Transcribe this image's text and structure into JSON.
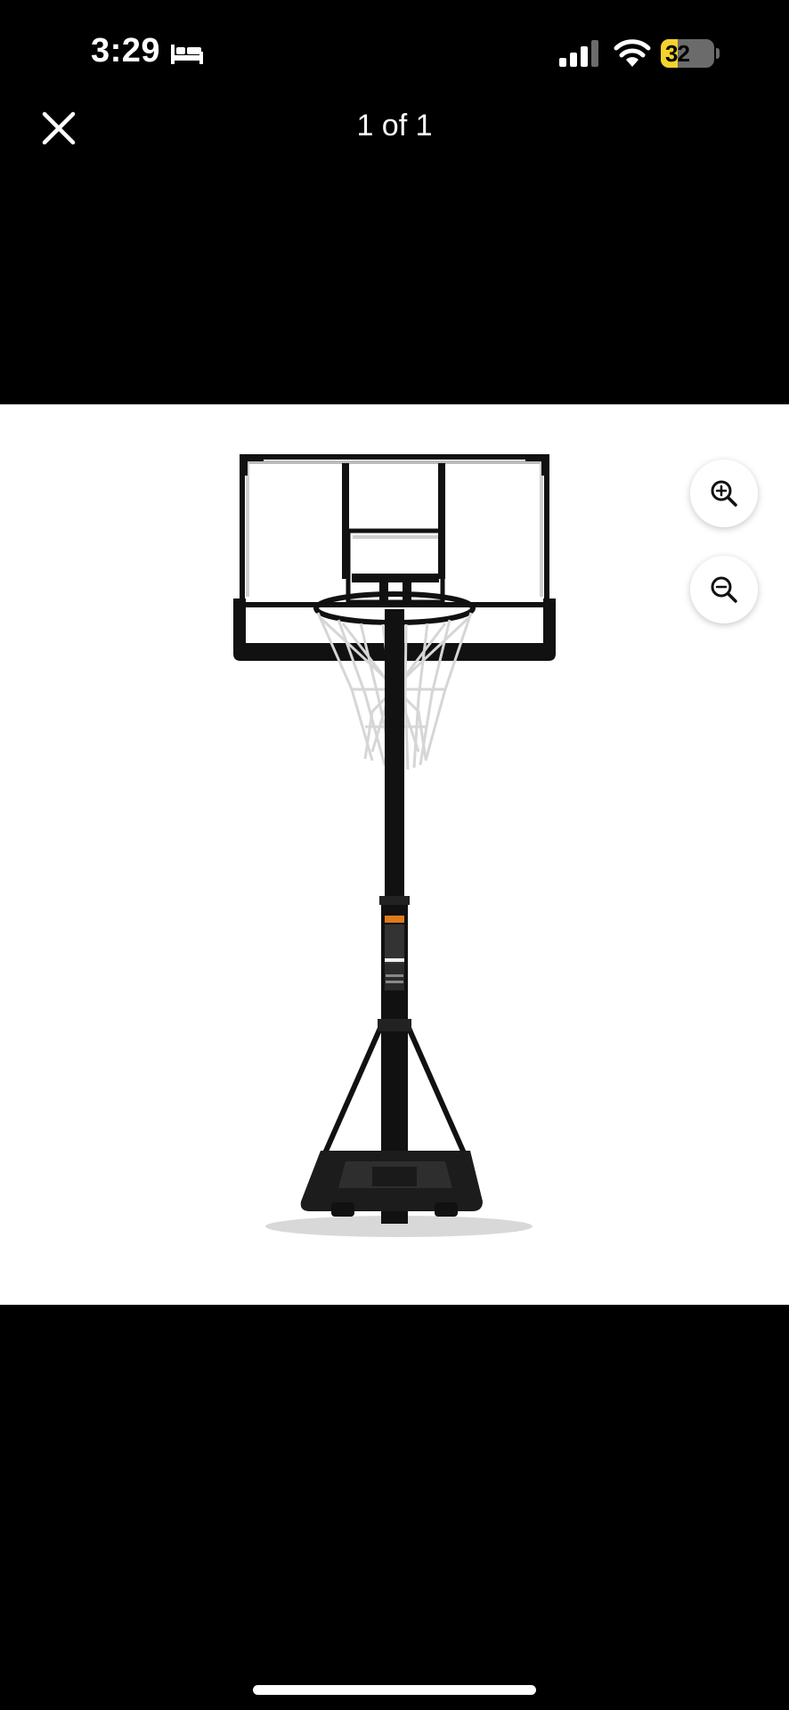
{
  "status_bar": {
    "time": "3:29",
    "battery_percent": "32",
    "battery_level": 0.32,
    "icons": [
      "bed-icon",
      "signal-icon",
      "wifi-icon",
      "battery-icon"
    ]
  },
  "viewer": {
    "close_icon": "close-icon",
    "title": "1 of 1"
  },
  "image": {
    "subject": "basketball-hoop",
    "zoom_in_icon": "zoom-in-icon",
    "zoom_out_icon": "zoom-out-icon"
  },
  "colors": {
    "background": "#000000",
    "image_background": "#ffffff",
    "battery_fill": "#f4d32c"
  }
}
